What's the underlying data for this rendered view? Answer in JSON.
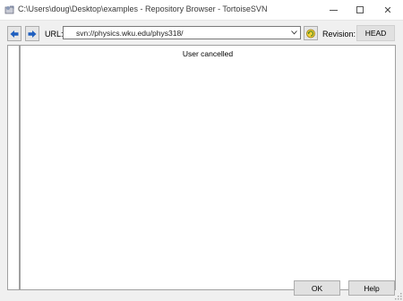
{
  "window": {
    "title": "C:\\Users\\doug\\Desktop\\examples - Repository Browser - TortoiseSVN",
    "minimize": "minimize",
    "maximize": "maximize",
    "close": "✕"
  },
  "toolbar": {
    "url_label": "URL:",
    "url_value": "svn://physics.wku.edu/phys318/",
    "revision_label": "Revision:",
    "revision_button": "HEAD"
  },
  "main": {
    "status": "User cancelled"
  },
  "buttons": {
    "ok": "OK",
    "help": "Help"
  },
  "colors": {
    "nav_arrow": "#1f5fbf",
    "refresh_icon": "#e8c21c"
  }
}
